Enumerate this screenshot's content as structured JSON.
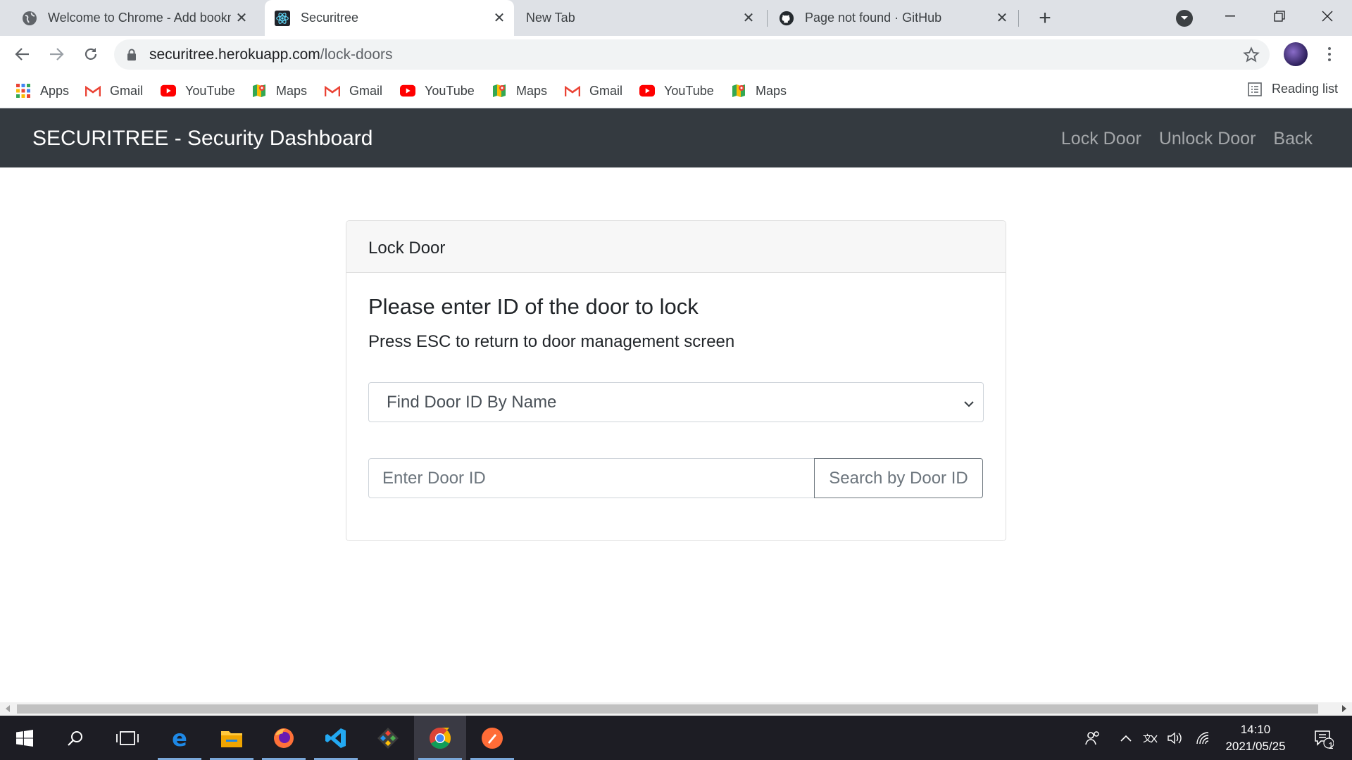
{
  "browser": {
    "tabs": [
      {
        "title": "Welcome to Chrome - Add bookmarks",
        "icon": "globe-icon",
        "active": false
      },
      {
        "title": "Securitree",
        "icon": "react-icon",
        "active": true
      },
      {
        "title": "New Tab",
        "icon": "",
        "active": false
      },
      {
        "title": "Page not found · GitHub",
        "icon": "github-icon",
        "active": false
      }
    ],
    "url_host": "securitree.herokuapp.com",
    "url_path": "/lock-doors",
    "bookmarks": [
      {
        "label": "Apps",
        "icon": "apps-grid-icon"
      },
      {
        "label": "Gmail",
        "icon": "gmail-icon"
      },
      {
        "label": "YouTube",
        "icon": "youtube-icon"
      },
      {
        "label": "Maps",
        "icon": "maps-icon"
      },
      {
        "label": "Gmail",
        "icon": "gmail-icon"
      },
      {
        "label": "YouTube",
        "icon": "youtube-icon"
      },
      {
        "label": "Maps",
        "icon": "maps-icon"
      },
      {
        "label": "Gmail",
        "icon": "gmail-icon"
      },
      {
        "label": "YouTube",
        "icon": "youtube-icon"
      },
      {
        "label": "Maps",
        "icon": "maps-icon"
      }
    ],
    "reading_list": "Reading list"
  },
  "app": {
    "brand": "SECURITREE - Security Dashboard",
    "nav": [
      "Lock Door",
      "Unlock Door",
      "Back"
    ],
    "card": {
      "header": "Lock Door",
      "title": "Please enter ID of the door to lock",
      "text": "Press ESC to return to door management screen",
      "select_value": "Find Door ID By Name",
      "input_placeholder": "Enter Door ID",
      "search_button": "Search by Door ID"
    }
  },
  "taskbar": {
    "time": "14:10",
    "date": "2021/05/25",
    "notification_count": "1"
  },
  "colors": {
    "navbar": "#343a40",
    "tabstrip": "#dee1e6",
    "taskbar": "#1d1d24"
  }
}
